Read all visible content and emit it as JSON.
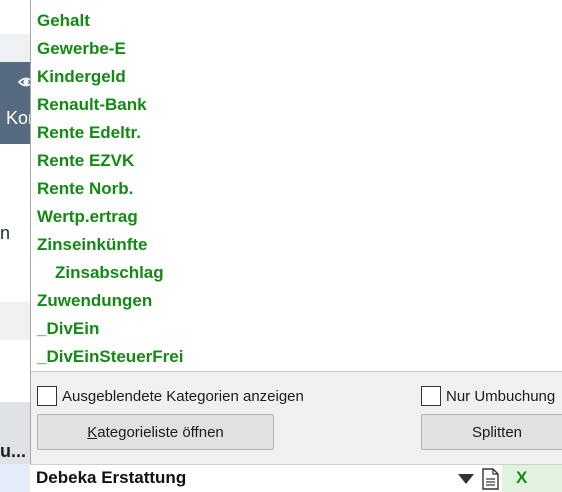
{
  "background": {
    "partial_label_1": "Kor",
    "partial_label_2": "n",
    "partial_label_3": "u..."
  },
  "categories": [
    {
      "label": "Gehalt",
      "indent": false
    },
    {
      "label": "Gewerbe-E",
      "indent": false
    },
    {
      "label": "Kindergeld",
      "indent": false
    },
    {
      "label": "Renault-Bank",
      "indent": false
    },
    {
      "label": "Rente Edeltr.",
      "indent": false
    },
    {
      "label": "Rente EZVK",
      "indent": false
    },
    {
      "label": "Rente Norb.",
      "indent": false
    },
    {
      "label": "Wertp.ertrag",
      "indent": false
    },
    {
      "label": "Zinseinkünfte",
      "indent": false
    },
    {
      "label": "Zinsabschlag",
      "indent": true
    },
    {
      "label": "Zuwendungen",
      "indent": false
    },
    {
      "label": "_DivEin",
      "indent": false
    },
    {
      "label": "_DivEinSteuerFrei",
      "indent": false
    }
  ],
  "options": {
    "show_hidden_label": "Ausgeblendete Kategorien anzeigen",
    "show_hidden_checked": false,
    "only_transfers_label": "Nur Umbuchung",
    "only_transfers_checked": false,
    "open_list_button_first": "K",
    "open_list_button_rest": "ategorieliste öffnen",
    "split_button": "Splitten"
  },
  "input_row": {
    "category_value": "Debeka Erstattung",
    "dropdown_icon": "triangle-down-icon",
    "document_icon": "document-icon",
    "clear_label": "X"
  },
  "colors": {
    "category_text": "#138a13",
    "panel_bg": "#f0f0f0",
    "button_bg": "#e1e1e1",
    "clear_cell_bg": "#dff3df",
    "sidebar_dark": "#566a80"
  }
}
